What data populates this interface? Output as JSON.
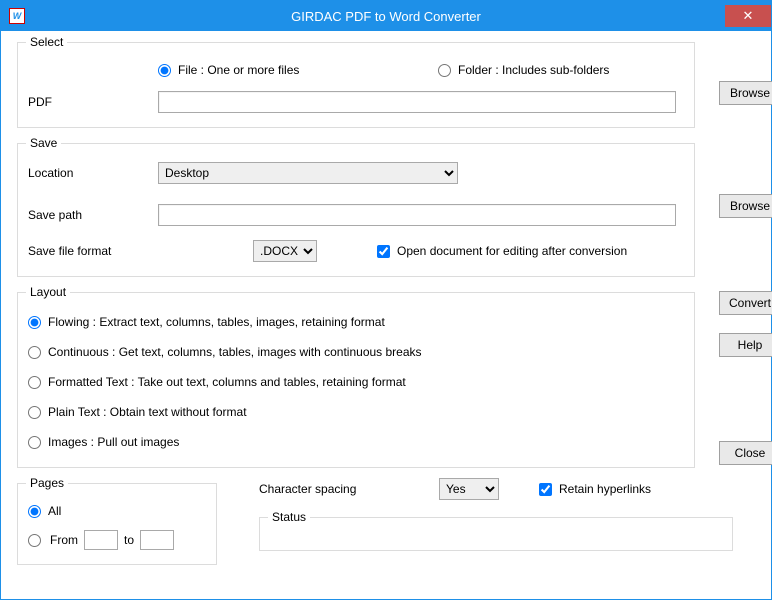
{
  "titlebar": {
    "title": "GIRDAC PDF to Word Converter",
    "close_symbol": "✕",
    "icon_letter": "W"
  },
  "select": {
    "legend": "Select",
    "radio_file_label": "File :  One or more files",
    "radio_folder_label": "Folder :  Includes sub-folders",
    "selected": "file",
    "pdf_label": "PDF",
    "pdf_value": "",
    "browse_label": "Browse"
  },
  "save": {
    "legend": "Save",
    "location_label": "Location",
    "location_value": "Desktop",
    "savepath_label": "Save path",
    "savepath_value": "",
    "browse_label": "Browse",
    "format_label": "Save file format",
    "format_value": ".DOCX",
    "open_after_label": "Open document for editing after conversion",
    "open_after_checked": true
  },
  "layout": {
    "legend": "Layout",
    "selected": "flowing",
    "options": {
      "flowing": "Flowing :  Extract text, columns, tables, images, retaining format",
      "continuous": "Continuous :  Get text, columns, tables, images with continuous breaks",
      "formatted": "Formatted Text :  Take out text, columns and tables, retaining format",
      "plain": "Plain Text :  Obtain text without format",
      "images": "Images :  Pull out images"
    }
  },
  "side": {
    "convert_label": "Convert",
    "help_label": "Help",
    "close_label": "Close"
  },
  "pages": {
    "legend": "Pages",
    "all_label": "All",
    "from_label": "From",
    "to_label": "to",
    "selected": "all",
    "from_value": "",
    "to_value": ""
  },
  "bottom": {
    "charspacing_label": "Character spacing",
    "charspacing_value": "Yes",
    "retain_hyperlinks_label": "Retain hyperlinks",
    "retain_hyperlinks_checked": true,
    "status_legend": "Status"
  }
}
